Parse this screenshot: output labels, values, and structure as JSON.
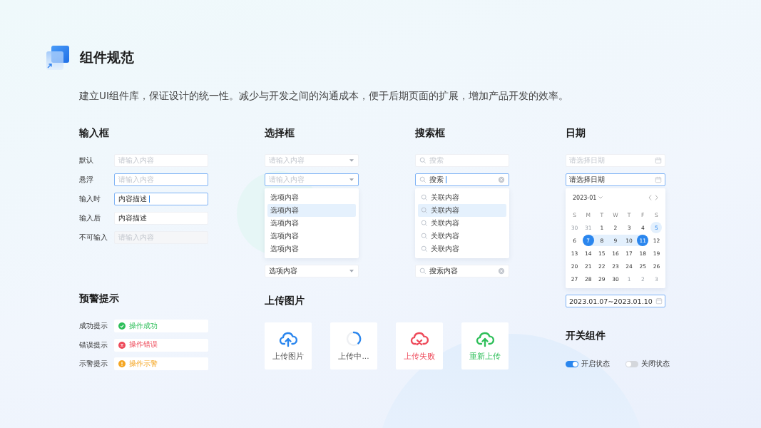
{
  "header": {
    "title": "组件规范",
    "description": "建立UI组件库，保证设计的统一性。减少与开发之间的沟通成本，便于后期页面的扩展，增加产品开发的效率。"
  },
  "inputs": {
    "title": "输入框",
    "rows": [
      {
        "label": "默认",
        "kind": "default",
        "placeholder": "请输入内容"
      },
      {
        "label": "悬浮",
        "kind": "hover",
        "placeholder": "请输入内容"
      },
      {
        "label": "输入时",
        "kind": "focus",
        "value": "内容描述",
        "cursor": true
      },
      {
        "label": "输入后",
        "kind": "default",
        "value": "内容描述"
      },
      {
        "label": "不可输入",
        "kind": "disabled",
        "placeholder": "请输入内容"
      }
    ]
  },
  "select": {
    "title": "选择框",
    "fields": [
      {
        "kind": "default",
        "placeholder": "请输入内容"
      },
      {
        "kind": "focus",
        "placeholder": "请输入内容"
      }
    ],
    "options": [
      {
        "label": "选项内容",
        "selected": false
      },
      {
        "label": "选项内容",
        "selected": true
      },
      {
        "label": "选项内容",
        "selected": false
      },
      {
        "label": "选项内容",
        "selected": false
      },
      {
        "label": "选项内容",
        "selected": false
      }
    ],
    "result": {
      "value": "选项内容"
    }
  },
  "search": {
    "title": "搜索框",
    "fields": [
      {
        "kind": "default",
        "placeholder": "搜索"
      },
      {
        "kind": "focus",
        "value": "搜索",
        "cursor": true
      }
    ],
    "suggestions": [
      {
        "label": "关联内容",
        "selected": false
      },
      {
        "label": "关联内容",
        "selected": true
      },
      {
        "label": "关联内容",
        "selected": false
      },
      {
        "label": "关联内容",
        "selected": false
      },
      {
        "label": "关联内容",
        "selected": false
      }
    ],
    "result": {
      "value": "搜索内容"
    }
  },
  "date": {
    "title": "日期",
    "fields": [
      {
        "kind": "default",
        "placeholder": "请选择日期"
      },
      {
        "kind": "focus",
        "value": "请选择日期"
      }
    ],
    "calendar": {
      "month": "2023-01",
      "weekdays": [
        "S",
        "M",
        "T",
        "W",
        "T",
        "F",
        "S"
      ],
      "days": [
        {
          "label": "30",
          "kind": "outside",
          "selected": false
        },
        {
          "label": "31",
          "kind": "outside",
          "selected": false
        },
        {
          "label": "1",
          "kind": "day",
          "selected": false
        },
        {
          "label": "2",
          "kind": "day",
          "selected": false
        },
        {
          "label": "3",
          "kind": "day",
          "selected": false
        },
        {
          "label": "4",
          "kind": "day",
          "selected": false
        },
        {
          "label": "5",
          "kind": "today",
          "selected": false
        },
        {
          "label": "6",
          "kind": "day",
          "selected": false
        },
        {
          "label": "7",
          "kind": "range",
          "selected": true
        },
        {
          "label": "8",
          "kind": "range",
          "selected": false
        },
        {
          "label": "9",
          "kind": "range",
          "selected": false
        },
        {
          "label": "10",
          "kind": "range",
          "selected": false
        },
        {
          "label": "11",
          "kind": "range",
          "selected": true
        },
        {
          "label": "12",
          "kind": "day",
          "selected": false
        },
        {
          "label": "13",
          "kind": "day",
          "selected": false
        },
        {
          "label": "14",
          "kind": "day",
          "selected": false
        },
        {
          "label": "15",
          "kind": "day",
          "selected": false
        },
        {
          "label": "16",
          "kind": "day",
          "selected": false
        },
        {
          "label": "17",
          "kind": "day",
          "selected": false
        },
        {
          "label": "18",
          "kind": "day",
          "selected": false
        },
        {
          "label": "19",
          "kind": "day",
          "selected": false
        },
        {
          "label": "20",
          "kind": "day",
          "selected": false
        },
        {
          "label": "21",
          "kind": "day",
          "selected": false
        },
        {
          "label": "22",
          "kind": "day",
          "selected": false
        },
        {
          "label": "23",
          "kind": "day",
          "selected": false
        },
        {
          "label": "24",
          "kind": "day",
          "selected": false
        },
        {
          "label": "25",
          "kind": "day",
          "selected": false
        },
        {
          "label": "26",
          "kind": "day",
          "selected": false
        },
        {
          "label": "27",
          "kind": "day",
          "selected": false
        },
        {
          "label": "28",
          "kind": "day",
          "selected": false
        },
        {
          "label": "29",
          "kind": "day",
          "selected": false
        },
        {
          "label": "30",
          "kind": "day",
          "selected": false
        },
        {
          "label": "1",
          "kind": "outside",
          "selected": false
        },
        {
          "label": "2",
          "kind": "outside",
          "selected": false
        },
        {
          "label": "3",
          "kind": "outside",
          "selected": false
        }
      ]
    },
    "range": {
      "kind": "focus",
      "value": "2023.01.07~2023.01.10"
    }
  },
  "alerts": {
    "title": "预警提示",
    "rows": [
      {
        "label": "成功提示",
        "kind": "success",
        "message": "操作成功"
      },
      {
        "label": "错误提示",
        "kind": "error",
        "message": "操作错误"
      },
      {
        "label": "示警提示",
        "kind": "warning",
        "message": "操作示警"
      }
    ]
  },
  "upload": {
    "title": "上传图片",
    "cards": [
      {
        "kind": "idle",
        "label": "上传图片"
      },
      {
        "kind": "loading",
        "label": "上传中..."
      },
      {
        "kind": "failed",
        "label": "上传失败"
      },
      {
        "kind": "retry",
        "label": "重新上传"
      }
    ]
  },
  "switches": {
    "title": "开关组件",
    "items": [
      {
        "label": "开启状态",
        "on": true
      },
      {
        "label": "关闭状态",
        "on": false
      }
    ]
  }
}
